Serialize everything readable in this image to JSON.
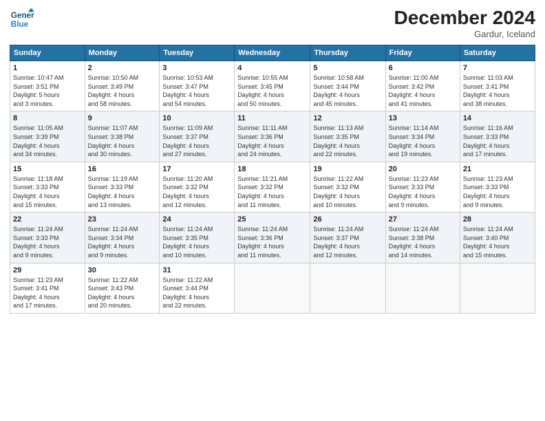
{
  "header": {
    "logo_line1": "General",
    "logo_line2": "Blue",
    "month": "December 2024",
    "location": "Gardur, Iceland"
  },
  "days_of_week": [
    "Sunday",
    "Monday",
    "Tuesday",
    "Wednesday",
    "Thursday",
    "Friday",
    "Saturday"
  ],
  "weeks": [
    [
      {
        "day": "1",
        "info": "Sunrise: 10:47 AM\nSunset: 3:51 PM\nDaylight: 5 hours\nand 3 minutes."
      },
      {
        "day": "2",
        "info": "Sunrise: 10:50 AM\nSunset: 3:49 PM\nDaylight: 4 hours\nand 58 minutes."
      },
      {
        "day": "3",
        "info": "Sunrise: 10:53 AM\nSunset: 3:47 PM\nDaylight: 4 hours\nand 54 minutes."
      },
      {
        "day": "4",
        "info": "Sunrise: 10:55 AM\nSunset: 3:45 PM\nDaylight: 4 hours\nand 50 minutes."
      },
      {
        "day": "5",
        "info": "Sunrise: 10:58 AM\nSunset: 3:44 PM\nDaylight: 4 hours\nand 45 minutes."
      },
      {
        "day": "6",
        "info": "Sunrise: 11:00 AM\nSunset: 3:42 PM\nDaylight: 4 hours\nand 41 minutes."
      },
      {
        "day": "7",
        "info": "Sunrise: 11:03 AM\nSunset: 3:41 PM\nDaylight: 4 hours\nand 38 minutes."
      }
    ],
    [
      {
        "day": "8",
        "info": "Sunrise: 11:05 AM\nSunset: 3:39 PM\nDaylight: 4 hours\nand 34 minutes."
      },
      {
        "day": "9",
        "info": "Sunrise: 11:07 AM\nSunset: 3:38 PM\nDaylight: 4 hours\nand 30 minutes."
      },
      {
        "day": "10",
        "info": "Sunrise: 11:09 AM\nSunset: 3:37 PM\nDaylight: 4 hours\nand 27 minutes."
      },
      {
        "day": "11",
        "info": "Sunrise: 11:11 AM\nSunset: 3:36 PM\nDaylight: 4 hours\nand 24 minutes."
      },
      {
        "day": "12",
        "info": "Sunrise: 11:13 AM\nSunset: 3:35 PM\nDaylight: 4 hours\nand 22 minutes."
      },
      {
        "day": "13",
        "info": "Sunrise: 11:14 AM\nSunset: 3:34 PM\nDaylight: 4 hours\nand 19 minutes."
      },
      {
        "day": "14",
        "info": "Sunrise: 11:16 AM\nSunset: 3:33 PM\nDaylight: 4 hours\nand 17 minutes."
      }
    ],
    [
      {
        "day": "15",
        "info": "Sunrise: 11:18 AM\nSunset: 3:33 PM\nDaylight: 4 hours\nand 15 minutes."
      },
      {
        "day": "16",
        "info": "Sunrise: 11:19 AM\nSunset: 3:33 PM\nDaylight: 4 hours\nand 13 minutes."
      },
      {
        "day": "17",
        "info": "Sunrise: 11:20 AM\nSunset: 3:32 PM\nDaylight: 4 hours\nand 12 minutes."
      },
      {
        "day": "18",
        "info": "Sunrise: 11:21 AM\nSunset: 3:32 PM\nDaylight: 4 hours\nand 11 minutes."
      },
      {
        "day": "19",
        "info": "Sunrise: 11:22 AM\nSunset: 3:32 PM\nDaylight: 4 hours\nand 10 minutes."
      },
      {
        "day": "20",
        "info": "Sunrise: 11:23 AM\nSunset: 3:33 PM\nDaylight: 4 hours\nand 9 minutes."
      },
      {
        "day": "21",
        "info": "Sunrise: 11:23 AM\nSunset: 3:33 PM\nDaylight: 4 hours\nand 9 minutes."
      }
    ],
    [
      {
        "day": "22",
        "info": "Sunrise: 11:24 AM\nSunset: 3:33 PM\nDaylight: 4 hours\nand 9 minutes."
      },
      {
        "day": "23",
        "info": "Sunrise: 11:24 AM\nSunset: 3:34 PM\nDaylight: 4 hours\nand 9 minutes."
      },
      {
        "day": "24",
        "info": "Sunrise: 11:24 AM\nSunset: 3:35 PM\nDaylight: 4 hours\nand 10 minutes."
      },
      {
        "day": "25",
        "info": "Sunrise: 11:24 AM\nSunset: 3:36 PM\nDaylight: 4 hours\nand 11 minutes."
      },
      {
        "day": "26",
        "info": "Sunrise: 11:24 AM\nSunset: 3:37 PM\nDaylight: 4 hours\nand 12 minutes."
      },
      {
        "day": "27",
        "info": "Sunrise: 11:24 AM\nSunset: 3:38 PM\nDaylight: 4 hours\nand 14 minutes."
      },
      {
        "day": "28",
        "info": "Sunrise: 11:24 AM\nSunset: 3:40 PM\nDaylight: 4 hours\nand 15 minutes."
      }
    ],
    [
      {
        "day": "29",
        "info": "Sunrise: 11:23 AM\nSunset: 3:41 PM\nDaylight: 4 hours\nand 17 minutes."
      },
      {
        "day": "30",
        "info": "Sunrise: 11:22 AM\nSunset: 3:43 PM\nDaylight: 4 hours\nand 20 minutes."
      },
      {
        "day": "31",
        "info": "Sunrise: 11:22 AM\nSunset: 3:44 PM\nDaylight: 4 hours\nand 22 minutes."
      },
      {
        "day": "",
        "info": ""
      },
      {
        "day": "",
        "info": ""
      },
      {
        "day": "",
        "info": ""
      },
      {
        "day": "",
        "info": ""
      }
    ]
  ]
}
